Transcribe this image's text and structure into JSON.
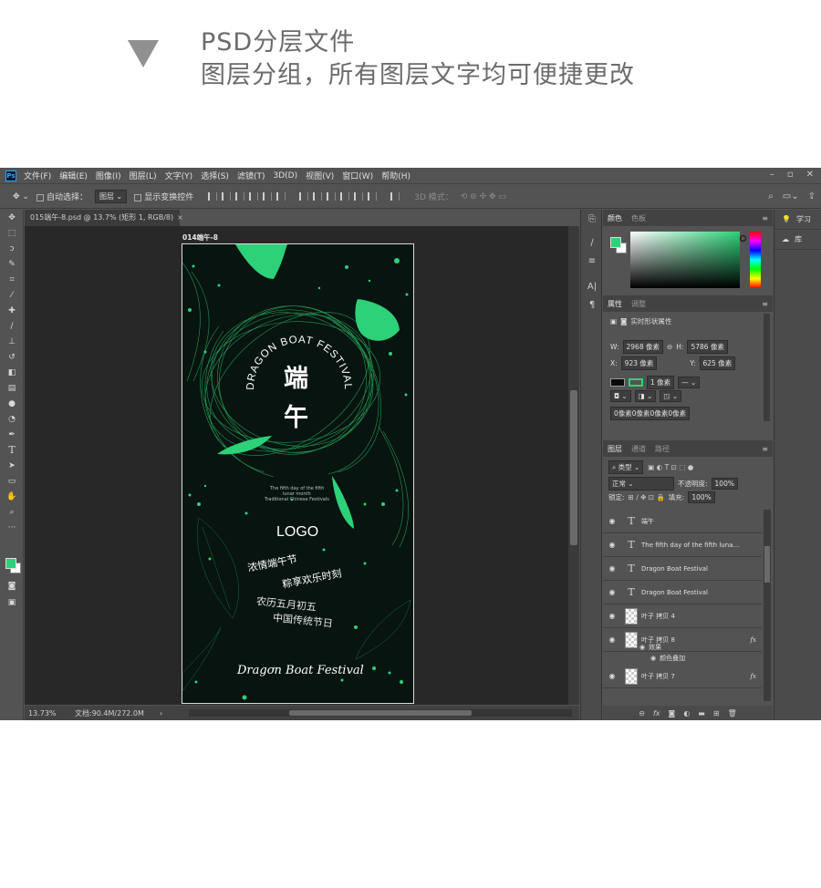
{
  "promo": {
    "line1": "PSD分层文件",
    "line2": "图层分组，所有图层文字均可便捷更改"
  },
  "menu": [
    "文件(F)",
    "编辑(E)",
    "图像(I)",
    "图层(L)",
    "文字(Y)",
    "选择(S)",
    "滤镜(T)",
    "3D(D)",
    "视图(V)",
    "窗口(W)",
    "帮助(H)"
  ],
  "app_icon": "Ps",
  "options": {
    "auto_select": "自动选择：",
    "auto_select_target": "图层",
    "show_transform": "显示变换控件",
    "mode_3d": "3D 模式："
  },
  "doc_tab": "015端午-8.psd @ 13.7% (矩形 1, RGB/8)",
  "artboard": {
    "label": "014端午-8",
    "arc_text": "DRAGON BOAT FESTIVAL",
    "big1": "端",
    "big2": "午",
    "sub1": "The fifth day of the fifth",
    "sub2": "lunar month",
    "sub3": "Traditional Chinese Festivals",
    "logo": "LOGO",
    "line1": "浓情端午节",
    "line2": "粽享欢乐时刻",
    "line3": "农历五月初五",
    "line4": "中国传统节日",
    "script": "Dragon Boat Festival"
  },
  "status": {
    "zoom": "13.73%",
    "doc": "文档:90.4M/272.0M"
  },
  "color_panel": {
    "tabs": [
      "颜色",
      "色板"
    ],
    "fg_color": "#2dd178"
  },
  "props_panel": {
    "tabs": [
      "属性",
      "调整"
    ],
    "title": "实时形状属性",
    "w_label": "W:",
    "w_value": "2968 像素",
    "h_label": "H:",
    "h_value": "5786 像素",
    "x_label": "X:",
    "x_value": "923 像素",
    "y_label": "Y:",
    "y_value": "625 像素",
    "stroke": "1 像素",
    "radius": "0像素0像素0像素0像素"
  },
  "layers_panel": {
    "tabs": [
      "图层",
      "通道",
      "路径"
    ],
    "filter": "类型",
    "blend": "正常",
    "opacity_label": "不透明度:",
    "opacity": "100%",
    "lock_label": "锁定:",
    "fill_label": "填充:",
    "fill": "100%",
    "layers": [
      {
        "kind": "text",
        "name": "端午"
      },
      {
        "kind": "text",
        "name": "The fifth day of the fifth  lunar..."
      },
      {
        "kind": "text",
        "name": "Dragon Boat Festival"
      },
      {
        "kind": "text",
        "name": "Dragon Boat Festival"
      },
      {
        "kind": "image",
        "name": "叶子 拷贝 4"
      },
      {
        "kind": "image",
        "name": "叶子 拷贝 8"
      },
      {
        "kind": "image",
        "name": "叶子 拷贝 7"
      }
    ],
    "effects": "效果",
    "color_overlay": "颜色叠加",
    "fx": "fx"
  },
  "dock_right": [
    "学习",
    "库"
  ]
}
